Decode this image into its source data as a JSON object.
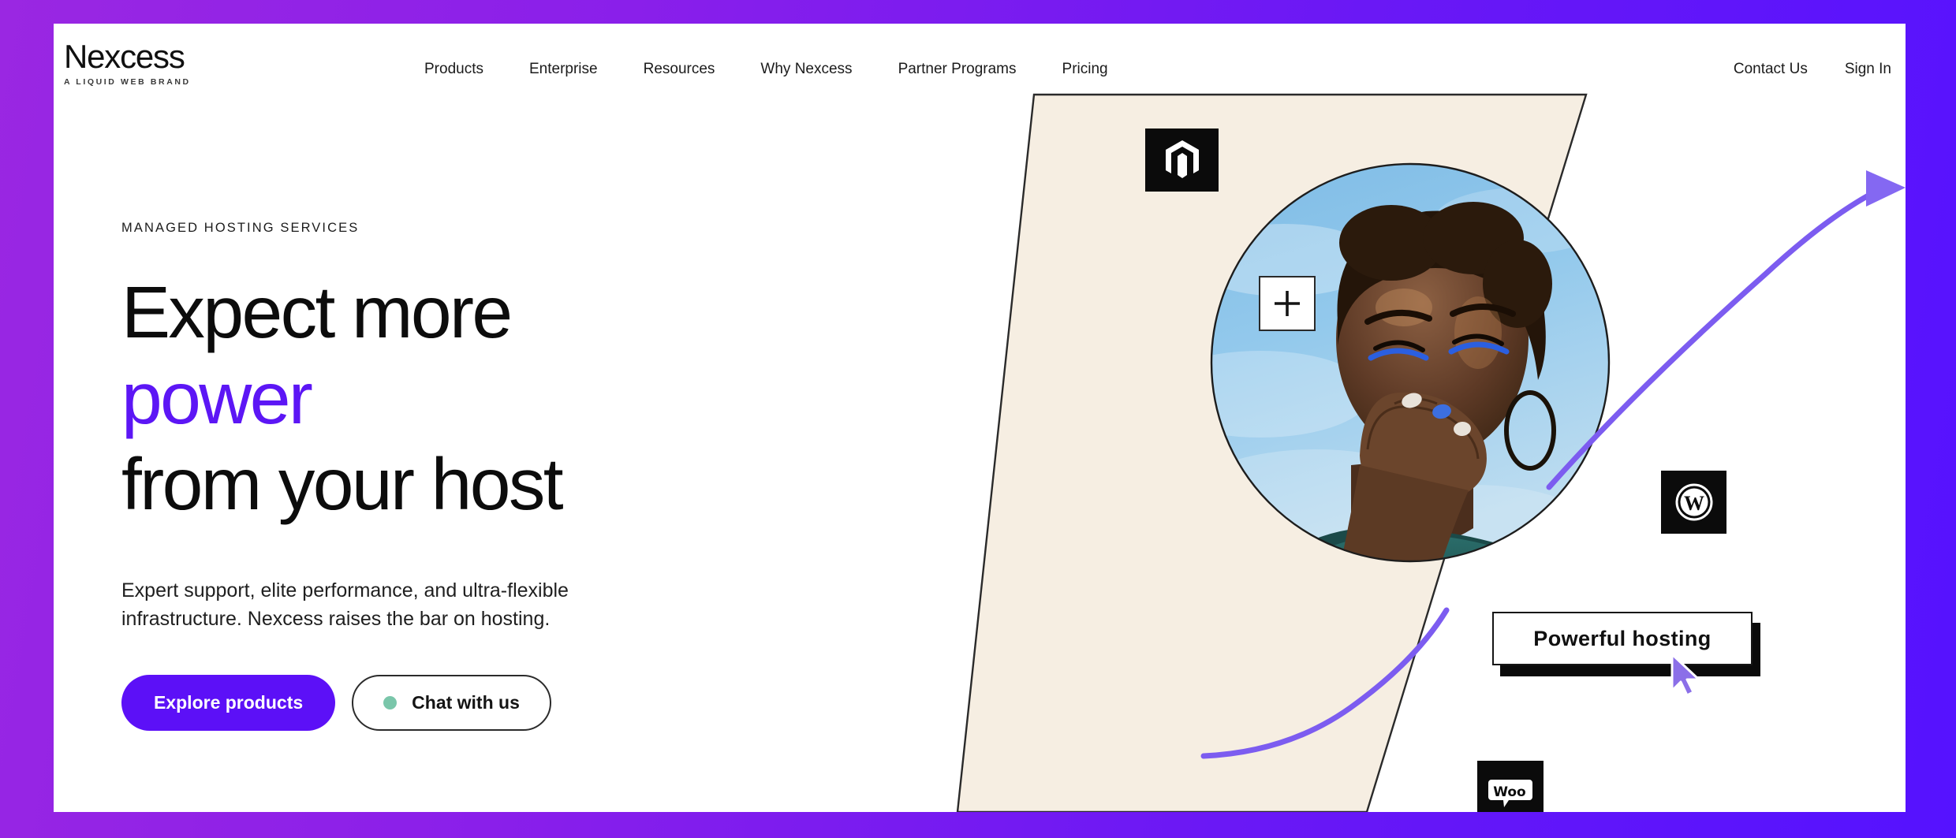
{
  "theme": {
    "frame_gradient_from": "#9A27E2",
    "frame_gradient_to": "#5512FF",
    "accent_purple": "#5C16F5",
    "button_purple": "#5C10F7",
    "chat_dot_green": "#7AC6AA",
    "cream_shape": "#F6EEE2",
    "cursor_purple": "#8B6FE8",
    "badge_black": "#0B0B0B",
    "photo_sky_blue": "#5FA6DC"
  },
  "header": {
    "logo": {
      "wordmark": "Nexcess",
      "tagline": "A LIQUID WEB BRAND"
    },
    "main_nav": [
      {
        "label": "Products"
      },
      {
        "label": "Enterprise"
      },
      {
        "label": "Resources"
      },
      {
        "label": "Why Nexcess"
      },
      {
        "label": "Partner Programs"
      },
      {
        "label": "Pricing"
      }
    ],
    "util_nav": [
      {
        "label": "Contact Us"
      },
      {
        "label": "Sign In"
      }
    ]
  },
  "hero": {
    "eyebrow": "MANAGED HOSTING SERVICES",
    "headline": {
      "line1": "Expect more",
      "line2_accent": "power",
      "line3": "from your host"
    },
    "subtext": "Expert support, elite performance, and ultra-flexible infrastructure. Nexcess raises the bar on hosting.",
    "cta": {
      "primary_label": "Explore products",
      "secondary_label": "Chat with us"
    }
  },
  "artwork": {
    "tooltip_label": "Powerful hosting",
    "badges": [
      {
        "name": "magento",
        "alt": "Magento"
      },
      {
        "name": "wordpress",
        "alt": "WordPress"
      },
      {
        "name": "woocommerce",
        "alt": "Woo"
      }
    ],
    "plus_glyph": "+",
    "photo_alt": "Smiling woman with short hair against a blue sky"
  }
}
